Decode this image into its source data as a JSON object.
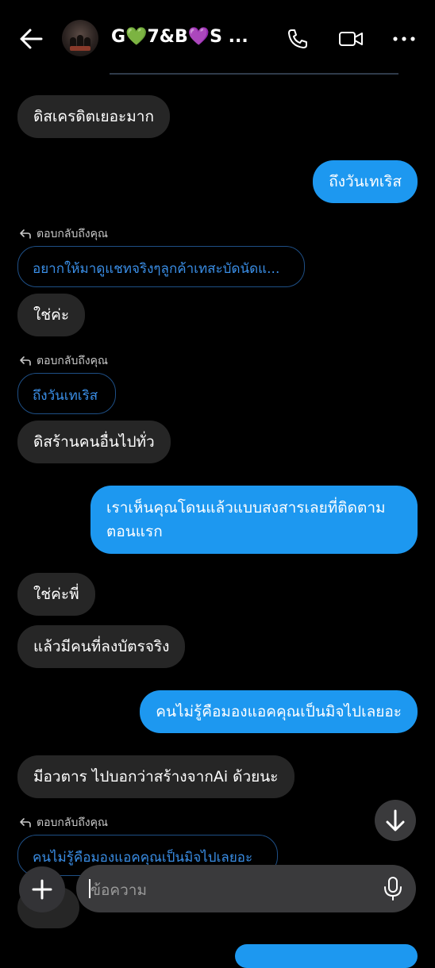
{
  "header": {
    "title": "G💚7&B💜S ...",
    "back_icon": "arrow-left-icon",
    "call_icon": "phone-icon",
    "video_icon": "video-camera-icon",
    "more_icon": "more-horizontal-icon"
  },
  "messages": [
    {
      "from": "them",
      "text": "ดิสเครดิตเยอะมาก"
    },
    {
      "from": "me",
      "text": "ถึงวันเทเริส"
    },
    {
      "from": "them",
      "reply_label": "ตอบกลับถึงคุณ",
      "quoted": "อยากให้มาดูแชทจริงๆลูกค้าเทสะบัดนัดแ...",
      "text": "ใช่ค่ะ"
    },
    {
      "from": "them",
      "reply_label": "ตอบกลับถึงคุณ",
      "quoted": "ถึงวันเทเริส",
      "text": "ดิสร้านคนอื่นไปทั่ว"
    },
    {
      "from": "me",
      "text": "เราเห็นคุณโดนแล้วแบบสงสารเลยที่ติดตามตอนแรก"
    },
    {
      "from": "them",
      "text": "ใช่ค่ะพี่"
    },
    {
      "from": "them",
      "text": "แล้วมีคนที่ลงบัตรจริง"
    },
    {
      "from": "me",
      "text": "คนไม่รู้คือมองแอคคุณเป็นมิจไปเลยอะ"
    },
    {
      "from": "them",
      "text": "มีอวตาร ไปบอกว่าสร้างจากAi ด้วยนะ"
    },
    {
      "from": "them",
      "reply_label": "ตอบกลับถึงคุณ",
      "quoted": "คนไม่รู้คือมองแอคคุณเป็นมิจไปเลยอะ"
    }
  ],
  "composer": {
    "placeholder": "ข้อความ",
    "plus_icon": "plus-icon",
    "mic_icon": "microphone-icon",
    "scroll_down_icon": "arrow-down-icon"
  },
  "colors": {
    "background": "#000000",
    "incoming_bubble": "#262626",
    "outgoing_bubble": "#1d98f0",
    "quote_text": "#3a8ee6"
  }
}
